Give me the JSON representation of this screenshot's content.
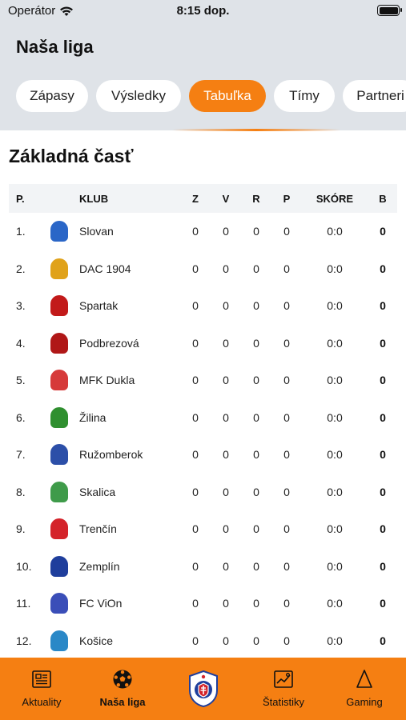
{
  "status": {
    "carrier": "Operátor",
    "time": "8:15 dop."
  },
  "app": {
    "title": "Naša liga"
  },
  "tabs": [
    {
      "label": "Zápasy",
      "active": false
    },
    {
      "label": "Výsledky",
      "active": false
    },
    {
      "label": "Tabuľka",
      "active": true
    },
    {
      "label": "Tímy",
      "active": false
    },
    {
      "label": "Partneri",
      "active": false
    }
  ],
  "section": {
    "title": "Základná časť"
  },
  "table": {
    "headers": {
      "pos": "P.",
      "club": "KLUB",
      "z": "Z",
      "v": "V",
      "r": "R",
      "p": "P",
      "score": "SKÓRE",
      "b": "B"
    },
    "rows": [
      {
        "pos": "1.",
        "club": "Slovan",
        "z": "0",
        "v": "0",
        "r": "0",
        "p": "0",
        "score": "0:0",
        "b": "0",
        "logo_color": "#2a66c7"
      },
      {
        "pos": "2.",
        "club": "DAC 1904",
        "z": "0",
        "v": "0",
        "r": "0",
        "p": "0",
        "score": "0:0",
        "b": "0",
        "logo_color": "#e0a21a"
      },
      {
        "pos": "3.",
        "club": "Spartak",
        "z": "0",
        "v": "0",
        "r": "0",
        "p": "0",
        "score": "0:0",
        "b": "0",
        "logo_color": "#c21a1a"
      },
      {
        "pos": "4.",
        "club": "Podbrezová",
        "z": "0",
        "v": "0",
        "r": "0",
        "p": "0",
        "score": "0:0",
        "b": "0",
        "logo_color": "#b01717"
      },
      {
        "pos": "5.",
        "club": "MFK Dukla",
        "z": "0",
        "v": "0",
        "r": "0",
        "p": "0",
        "score": "0:0",
        "b": "0",
        "logo_color": "#d63a3a"
      },
      {
        "pos": "6.",
        "club": "Žilina",
        "z": "0",
        "v": "0",
        "r": "0",
        "p": "0",
        "score": "0:0",
        "b": "0",
        "logo_color": "#2f8f2f"
      },
      {
        "pos": "7.",
        "club": "Ružomberok",
        "z": "0",
        "v": "0",
        "r": "0",
        "p": "0",
        "score": "0:0",
        "b": "0",
        "logo_color": "#2c4fa8"
      },
      {
        "pos": "8.",
        "club": "Skalica",
        "z": "0",
        "v": "0",
        "r": "0",
        "p": "0",
        "score": "0:0",
        "b": "0",
        "logo_color": "#3f9b4a"
      },
      {
        "pos": "9.",
        "club": "Trenčín",
        "z": "0",
        "v": "0",
        "r": "0",
        "p": "0",
        "score": "0:0",
        "b": "0",
        "logo_color": "#d4232a"
      },
      {
        "pos": "10.",
        "club": "Zemplín",
        "z": "0",
        "v": "0",
        "r": "0",
        "p": "0",
        "score": "0:0",
        "b": "0",
        "logo_color": "#1f3e9c"
      },
      {
        "pos": "11.",
        "club": "FC ViOn",
        "z": "0",
        "v": "0",
        "r": "0",
        "p": "0",
        "score": "0:0",
        "b": "0",
        "logo_color": "#3a4eb8"
      },
      {
        "pos": "12.",
        "club": "Košice",
        "z": "0",
        "v": "0",
        "r": "0",
        "p": "0",
        "score": "0:0",
        "b": "0",
        "logo_color": "#2a88c7"
      }
    ]
  },
  "tabbar": {
    "items": [
      {
        "label": "Aktuality",
        "icon": "newspaper-icon",
        "active": false
      },
      {
        "label": "Naša liga",
        "icon": "soccer-ball-icon",
        "active": true
      },
      {
        "label": "",
        "icon": "league-logo-icon",
        "active": false
      },
      {
        "label": "Štatistiky",
        "icon": "stats-icon",
        "active": false
      },
      {
        "label": "Gaming",
        "icon": "gaming-icon",
        "active": false
      }
    ]
  },
  "colors": {
    "accent": "#f57f12",
    "header_bg": "#dfe3e8",
    "table_header_bg": "#f2f4f6"
  }
}
